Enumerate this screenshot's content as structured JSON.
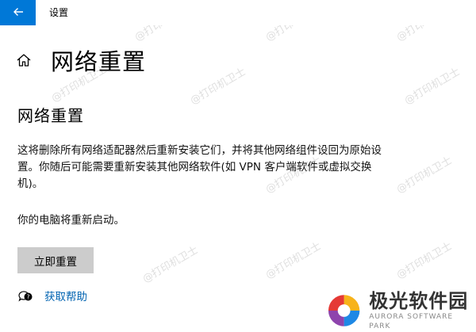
{
  "window": {
    "title": "设置"
  },
  "page": {
    "title": "网络重置"
  },
  "section": {
    "title": "网络重置",
    "description": "这将删除所有网络适配器然后重新安装它们，并将其他网络组件设回为原始设置。你随后可能需要重新安装其他网络软件(如 VPN 客户端软件或虚拟交换机)。",
    "restart_note": "你的电脑将重新启动。",
    "reset_button": "立即重置"
  },
  "help": {
    "link_label": "获取帮助"
  },
  "watermark": {
    "text": "@打印机卫士"
  },
  "logo": {
    "name": "极光软件园",
    "subtitle": "AURORA SOFTWARE PARK"
  },
  "colors": {
    "accent": "#0078d7",
    "link": "#0063b1",
    "button_bg": "#cccccc"
  },
  "icons": {
    "back": "arrow-left-icon",
    "home": "home-icon",
    "help": "chat-help-icon"
  }
}
